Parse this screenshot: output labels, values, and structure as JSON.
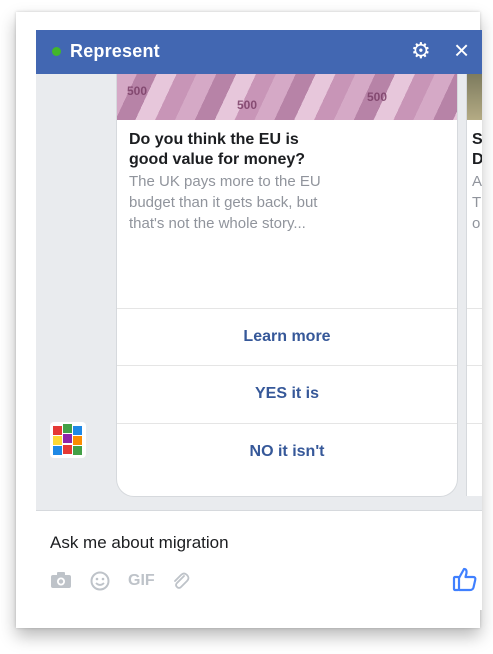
{
  "header": {
    "title": "Represent"
  },
  "card": {
    "banknote_label": "500",
    "title_line1": "Do you think the EU is",
    "title_line2": "good value for money?",
    "desc_line1": "The UK pays more to the EU",
    "desc_line2": "budget than it gets back, but",
    "desc_line3": "that's not the whole story...",
    "buttons": [
      "Learn more",
      "YES it is",
      "NO it isn't"
    ]
  },
  "card_next": {
    "title_line1": "S",
    "title_line2": "D",
    "desc_line1": "A",
    "desc_line2": "T",
    "desc_line3": "o"
  },
  "composer": {
    "text": "Ask me about migration",
    "gif_label": "GIF"
  },
  "colors": {
    "header": "#4267b2",
    "status": "#42b72a",
    "link": "#365899",
    "like": "#4080ff"
  },
  "icons": [
    "gear-icon",
    "close-icon",
    "camera-icon",
    "emoji-icon",
    "gif-icon",
    "paperclip-icon",
    "thumbs-up-icon"
  ]
}
